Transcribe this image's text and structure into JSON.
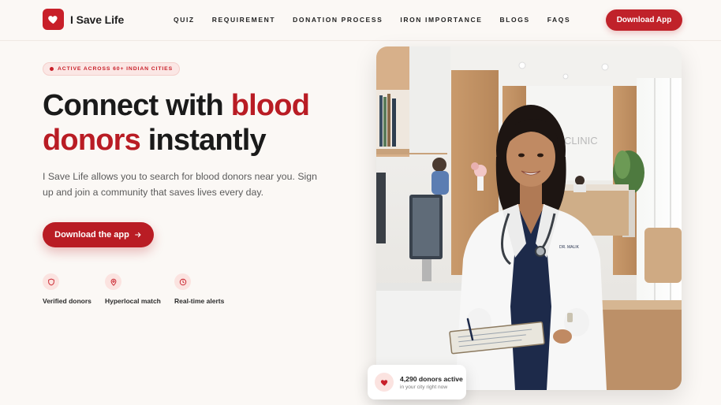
{
  "brand": {
    "name": "I Save Life",
    "icon": "heart-icon",
    "color": "#c8202a"
  },
  "nav": {
    "links": [
      "QUIZ",
      "REQUIREMENT",
      "DONATION PROCESS",
      "IRON IMPORTANCE",
      "BLOGS",
      "FAQS"
    ],
    "cta_label": "Download App"
  },
  "hero": {
    "badge": "ACTIVE ACROSS 60+ INDIAN CITIES",
    "headline_part1": "Connect with ",
    "headline_accent1": "blood",
    "headline_accent2": "donors",
    "headline_part2": " instantly",
    "lead": "I Save Life allows you to search for blood donors near you. Sign up and join a community that saves lives every day.",
    "cta_label": "Download the app",
    "cta_icon": "arrow-right-icon",
    "features": [
      {
        "label": "Verified donors",
        "icon": "shield-icon"
      },
      {
        "label": "Hyperlocal match",
        "icon": "map-pin-icon"
      },
      {
        "label": "Real-time alerts",
        "icon": "clock-icon"
      }
    ]
  },
  "stat_card": {
    "title": "4,290 donors active",
    "subtitle": "in your city right now",
    "icon": "heart-icon"
  },
  "photo": {
    "wall_sign": "CLINIC",
    "coat_tag": "DR. MALIK"
  }
}
